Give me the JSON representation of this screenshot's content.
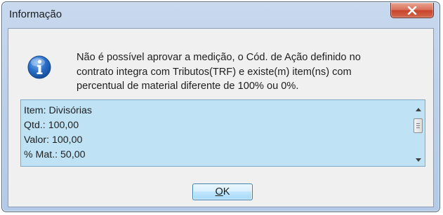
{
  "window": {
    "title": "Informação"
  },
  "titlebar": {
    "close_icon": "close-icon"
  },
  "message": {
    "icon": "info-icon",
    "lines": [
      "Não é possível aprovar a medição, o Cód. de Ação definido no",
      "contrato integra com Tributos(TRF) e existe(m) item(ns) com",
      "percentual de material diferente de 100% ou 0%."
    ]
  },
  "details": {
    "lines": [
      "Item: Divisórias",
      "Qtd.: 100,00",
      "Valor: 100,00",
      "% Mat.: 50,00"
    ]
  },
  "buttons": {
    "ok_mnemonic": "O",
    "ok_rest": "K"
  },
  "colors": {
    "detail_background": "#bfe3f5",
    "close_button": "#c7442b",
    "info_icon": "#2a6fc9"
  }
}
